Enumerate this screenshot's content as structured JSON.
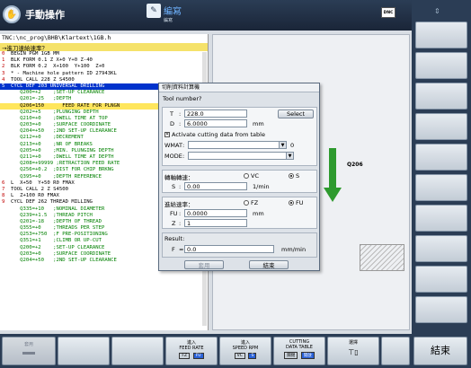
{
  "header": {
    "mode_title": "手動操作",
    "prog_title": "編寫",
    "prog_sub": "編寫",
    "dnc": "DNC"
  },
  "program": {
    "path": "TNC:\\nc_prog\\BHB\\Klartext\\1GB.h",
    "block_question": "→進刀速給速率？",
    "lines": [
      {
        "n": "0",
        "t": "BEGIN PGM 1GB MM",
        "c": ""
      },
      {
        "n": "1",
        "t": "BLK FORM 0.1 Z X+0 Y+0 Z-40",
        "c": ""
      },
      {
        "n": "2",
        "t": "BLK FORM 0.2  X+100  Y+100  Z+0",
        "c": ""
      },
      {
        "n": "3",
        "t": "* - Machine hole pattern ID 27943KL",
        "c": ""
      },
      {
        "n": "4",
        "t": "TOOL CALL 228 Z S4500",
        "c": ""
      },
      {
        "n": "5",
        "t": "CYCL DEF 203 UNIVERSAL DRILLING",
        "c": "hl"
      },
      {
        "n": "",
        "t": "   Q200=+2    ;SET-UP CLEARANCE",
        "c": "green"
      },
      {
        "n": "",
        "t": "   Q201=-25   ;DEPTH",
        "c": "green"
      },
      {
        "n": "",
        "t": "   Q206=150      FEED RATE FOR PLNGN",
        "c": "sel"
      },
      {
        "n": "",
        "t": "   Q202=+5    ;PLUNGING DEPTH",
        "c": "green"
      },
      {
        "n": "",
        "t": "   Q210=+0    ;DWELL TIME AT TOP",
        "c": "green"
      },
      {
        "n": "",
        "t": "   Q203=+0    ;SURFACE COORDINATE",
        "c": "green"
      },
      {
        "n": "",
        "t": "   Q204=+50   ;2ND SET-UP CLEARANCE",
        "c": "green"
      },
      {
        "n": "",
        "t": "   Q212=+0    ;DECREMENT",
        "c": "green"
      },
      {
        "n": "",
        "t": "   Q213=+0    ;NR OF BREAKS",
        "c": "green"
      },
      {
        "n": "",
        "t": "   Q205=+0    ;MIN. PLUNGING DEPTH",
        "c": "green"
      },
      {
        "n": "",
        "t": "   Q211=+0    ;DWELL TIME AT DEPTH",
        "c": "green"
      },
      {
        "n": "",
        "t": "   Q208=+99999 ;RETRACTION FEED RATE",
        "c": "green"
      },
      {
        "n": "",
        "t": "   Q256=+0.2  ;DIST FOR CHIP BRKNG",
        "c": "green"
      },
      {
        "n": "",
        "t": "   Q395=+0    ;DEPTH REFERENCE",
        "c": "green"
      },
      {
        "n": "6",
        "t": "L  X+50  Y+50 R0 FMAX",
        "c": ""
      },
      {
        "n": "7",
        "t": "TOOL CALL 2 Z S4500",
        "c": ""
      },
      {
        "n": "8",
        "t": "L  Z+100 R0 FMAX",
        "c": ""
      },
      {
        "n": "9",
        "t": "CYCL DEF 262 THREAD MILLING",
        "c": ""
      },
      {
        "n": "",
        "t": "   Q335=+10   ;NOMINAL DIAMETER",
        "c": "green"
      },
      {
        "n": "",
        "t": "   Q239=+1.5  ;THREAD PITCH",
        "c": "green"
      },
      {
        "n": "",
        "t": "   Q201=-18   ;DEPTH OF THREAD",
        "c": "green"
      },
      {
        "n": "",
        "t": "   Q355=+0    ;THREADS PER STEP",
        "c": "green"
      },
      {
        "n": "",
        "t": "   Q253=+750  ;F PRE-POSITIONING",
        "c": "green"
      },
      {
        "n": "",
        "t": "   Q351=+1    ;CLIMB OR UP-CUT",
        "c": "green"
      },
      {
        "n": "",
        "t": "   Q200=+2    ;SET-UP CLEARANCE",
        "c": "green"
      },
      {
        "n": "",
        "t": "   Q203=+0    ;SURFACE COORDINATE",
        "c": "green"
      },
      {
        "n": "",
        "t": "   Q204=+50   ;2ND SET-UP CLEARANCE",
        "c": "green"
      }
    ]
  },
  "graphic": {
    "q_label": "Q206"
  },
  "dialog": {
    "title": "切削資料計算機",
    "question": "Tool number?",
    "t_label": "T",
    "t_value": "228.0",
    "select_label": "Select",
    "d_label": "D",
    "d_value": "6.0000",
    "d_unit": "mm",
    "activate_label": "Activate cutting data from table",
    "wmat_label": "WMAT",
    "wmat_value": "0",
    "mode_label": "MODE",
    "spindle_title": "轉軸轉速：",
    "vc_label": "VC",
    "s_radio_label": "S",
    "s_label": "S",
    "s_value": "0.00",
    "s_unit": "1/min",
    "feed_title": "進給速率：",
    "fz_label": "FZ",
    "fu_radio_label": "FU",
    "fu_label": "FU",
    "fu_value": "0.0000",
    "fu_unit": "mm",
    "z_label": "Z",
    "z_value": "1",
    "result_title": "Result:",
    "f_label": "F",
    "f_value": "0.0",
    "f_unit": "mm/min",
    "apply_label": "套用",
    "end_label": "結束"
  },
  "softkeys": {
    "sk1_label": "套用",
    "sk4_l1": "進入",
    "sk4_l2": "FEED RATE",
    "sk4_tag1": "FZ",
    "sk4_tag2": "FU",
    "sk5_l1": "進入",
    "sk5_l2": "SPEED RPM",
    "sk5_tag1": "VC",
    "sk5_tag2": "S",
    "sk6_l1": "CUTTING",
    "sk6_l2": "DATA TABLE",
    "sk6_tag1": "關閉",
    "sk6_tag2": "開啟",
    "sk7_l1": "選擇",
    "end_label": "結束"
  }
}
